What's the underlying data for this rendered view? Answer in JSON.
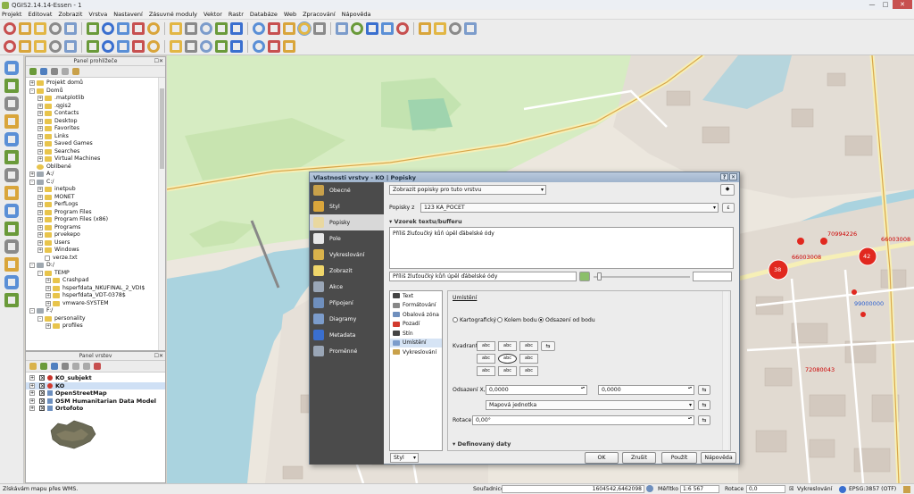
{
  "window": {
    "title": "QGIS2.14.14-Essen - 1",
    "controls": {
      "minimize": "—",
      "maximize": "□",
      "close": "✕"
    }
  },
  "menu": [
    "Projekt",
    "Editovat",
    "Zobrazit",
    "Vrstva",
    "Nastavení",
    "Zásuvné moduly",
    "Vektor",
    "Rastr",
    "Databáze",
    "Web",
    "Zpracování",
    "Nápověda"
  ],
  "toolbar_icons": {
    "row1": [
      "new-project-icon",
      "open-project-icon",
      "save-project-icon",
      "save-as-icon",
      "print-composer-icon",
      "composer-manager-icon",
      "pan-icon",
      "pan-to-selection-icon",
      "zoom-in-icon",
      "zoom-out-icon",
      "zoom-actual-icon",
      "zoom-full-icon",
      "zoom-selection-icon",
      "zoom-layer-icon",
      "zoom-last-icon",
      "zoom-next-icon",
      "new-map-view-icon",
      "refresh-icon",
      "identify-icon",
      "measure-icon",
      "select-icon",
      "deselect-icon",
      "attribute-table-icon",
      "statistics-icon",
      "calculator-icon",
      "annotation-icon",
      "text-annotation-icon",
      "map-tips-icon",
      "help-icon"
    ],
    "row2": [
      "toggle-edit-icon",
      "digitize-icon",
      "save-edits-icon",
      "add-feature-icon",
      "move-feature-icon",
      "node-tool-icon",
      "delete-icon",
      "cut-icon",
      "copy-icon",
      "paste-icon",
      "label-tool-icon",
      "pin-label-icon",
      "highlight-label-icon",
      "move-label-icon",
      "rotate-label-icon",
      "change-label-icon",
      "csw-icon",
      "python-icon"
    ]
  },
  "left_tools": [
    "add-vector-icon",
    "add-raster-icon",
    "add-postgis-icon",
    "add-spatialite-icon",
    "add-mssql-icon",
    "add-oracle-icon",
    "add-wms-icon",
    "add-wcs-icon",
    "add-wfs-icon",
    "add-delimited-icon",
    "add-virtual-icon",
    "new-shapefile-icon",
    "new-temp-layer-icon",
    "add-vector-dropdown-icon"
  ],
  "browser_panel": {
    "title": "Panel prohlížeče",
    "items": [
      {
        "label": "Projekt domů",
        "level": 0,
        "type": "folder",
        "exp": "+"
      },
      {
        "label": "Domů",
        "level": 0,
        "type": "folder",
        "exp": "-"
      },
      {
        "label": ".matplotlib",
        "level": 1,
        "type": "folder",
        "exp": "+"
      },
      {
        "label": ".qgis2",
        "level": 1,
        "type": "folder",
        "exp": "+"
      },
      {
        "label": "Contacts",
        "level": 1,
        "type": "folder",
        "exp": "+"
      },
      {
        "label": "Desktop",
        "level": 1,
        "type": "folder",
        "exp": "+"
      },
      {
        "label": "Favorites",
        "level": 1,
        "type": "folder",
        "exp": "+"
      },
      {
        "label": "Links",
        "level": 1,
        "type": "folder",
        "exp": "+"
      },
      {
        "label": "Saved Games",
        "level": 1,
        "type": "folder",
        "exp": "+"
      },
      {
        "label": "Searches",
        "level": 1,
        "type": "folder",
        "exp": "+"
      },
      {
        "label": "Virtual Machines",
        "level": 1,
        "type": "folder",
        "exp": "+"
      },
      {
        "label": "Oblíbené",
        "level": 0,
        "type": "star",
        "exp": ""
      },
      {
        "label": "A:/",
        "level": 0,
        "type": "drive",
        "exp": "+"
      },
      {
        "label": "C:/",
        "level": 0,
        "type": "drive",
        "exp": "-"
      },
      {
        "label": "inetpub",
        "level": 1,
        "type": "folder",
        "exp": "+"
      },
      {
        "label": "MONET",
        "level": 1,
        "type": "folder",
        "exp": "+"
      },
      {
        "label": "PerfLogs",
        "level": 1,
        "type": "folder",
        "exp": "+"
      },
      {
        "label": "Program Files",
        "level": 1,
        "type": "folder",
        "exp": "+"
      },
      {
        "label": "Program Files (x86)",
        "level": 1,
        "type": "folder",
        "exp": "+"
      },
      {
        "label": "Programs",
        "level": 1,
        "type": "folder",
        "exp": "+"
      },
      {
        "label": "prvekepo",
        "level": 1,
        "type": "folder",
        "exp": "+"
      },
      {
        "label": "Users",
        "level": 1,
        "type": "folder",
        "exp": "+"
      },
      {
        "label": "Windows",
        "level": 1,
        "type": "folder",
        "exp": "+"
      },
      {
        "label": "verze.txt",
        "level": 1,
        "type": "file",
        "exp": ""
      },
      {
        "label": "D:/",
        "level": 0,
        "type": "drive",
        "exp": "-"
      },
      {
        "label": "TEMP",
        "level": 1,
        "type": "folder",
        "exp": "-"
      },
      {
        "label": "Crashpad",
        "level": 2,
        "type": "folder",
        "exp": "+"
      },
      {
        "label": "hsperfdata_NKUFINAL_2_VDI$",
        "level": 2,
        "type": "folder",
        "exp": "+"
      },
      {
        "label": "hsperfdata_VDT-0378$",
        "level": 2,
        "type": "folder",
        "exp": "+"
      },
      {
        "label": "vmware-SYSTEM",
        "level": 2,
        "type": "folder",
        "exp": "+"
      },
      {
        "label": "F:/",
        "level": 0,
        "type": "drive",
        "exp": "-"
      },
      {
        "label": "personality",
        "level": 1,
        "type": "folder",
        "exp": "-"
      },
      {
        "label": "profiles",
        "level": 2,
        "type": "folder",
        "exp": "+"
      }
    ]
  },
  "layers_panel": {
    "title": "Panel vrstev",
    "layers": [
      {
        "name": "KO_subjekt",
        "checked": "✕",
        "color": "#c8322a",
        "selected": false,
        "indent": 0
      },
      {
        "name": "KO",
        "checked": "✕",
        "color": "#d23a2e",
        "selected": true,
        "indent": 0
      },
      {
        "name": "OpenStreetMap",
        "checked": "✕",
        "color": "#6c8fbf",
        "selected": false,
        "indent": 0
      },
      {
        "name": "OSM Humanitarian Data Model",
        "checked": "✕",
        "color": "#6c8fbf",
        "selected": false,
        "indent": 0
      },
      {
        "name": "Ortofoto",
        "checked": "✕",
        "color": "#6c8fbf",
        "selected": false,
        "indent": 0
      }
    ]
  },
  "map": {
    "labels": [
      {
        "text": "70994226"
      },
      {
        "text": "66003008"
      },
      {
        "text": "66003008"
      },
      {
        "text": "99000000"
      },
      {
        "text": "72080043"
      }
    ],
    "points": [
      {
        "label": "38"
      },
      {
        "label": "42"
      }
    ]
  },
  "dialog": {
    "title": "Vlastnosti vrstvy - KO | Popisky",
    "nav": [
      {
        "label": "Obecné",
        "icon": "wrench-icon",
        "color": "#c9a14a"
      },
      {
        "label": "Styl",
        "icon": "brush-icon",
        "color": "#d9a53b"
      },
      {
        "label": "Popisky",
        "icon": "label-icon",
        "color": "#e9d8a0",
        "active": true
      },
      {
        "label": "Pole",
        "icon": "fields-icon",
        "color": "#e8e8e8"
      },
      {
        "label": "Vykreslování",
        "icon": "paint-icon",
        "color": "#d9b24b"
      },
      {
        "label": "Zobrazit",
        "icon": "tooltip-icon",
        "color": "#f0d66a"
      },
      {
        "label": "Akce",
        "icon": "gear-icon",
        "color": "#9aa6b6"
      },
      {
        "label": "Připojení",
        "icon": "join-icon",
        "color": "#6f8fbd"
      },
      {
        "label": "Diagramy",
        "icon": "diagram-icon",
        "color": "#7c9ccb"
      },
      {
        "label": "Metadata",
        "icon": "info-icon",
        "color": "#3a6fcf"
      },
      {
        "label": "Proměnné",
        "icon": "variable-icon",
        "color": "#9aa6b6"
      }
    ],
    "mode_select": "Zobrazit popisky pro tuto vrstvu",
    "label_with_caption": "Popisky z",
    "label_field": "123 KA_POCET",
    "preview_section": "Vzorek textu/bufferu",
    "preview_text": "Příliš žluťoučký kůň úpěl ďábelské ódy",
    "sample_input": "Příliš žluťoučký kůň úpěl ďábelské ódy",
    "subnav": [
      {
        "label": "Text",
        "color": "#444"
      },
      {
        "label": "Formátování",
        "color": "#888"
      },
      {
        "label": "Obalová zóna",
        "color": "#6f8fbd"
      },
      {
        "label": "Pozadí",
        "color": "#d23a2e"
      },
      {
        "label": "Stín",
        "color": "#444"
      },
      {
        "label": "Umístění",
        "color": "#7c9ccb",
        "active": true
      },
      {
        "label": "Vykreslování",
        "color": "#c9a14a"
      }
    ],
    "placement": {
      "heading": "Umístění",
      "radios": [
        {
          "label": "Kartografický",
          "on": false
        },
        {
          "label": "Kolem bodu",
          "on": false
        },
        {
          "label": "Odsazení od bodu",
          "on": true
        }
      ],
      "quadrant_label": "Kvadrant",
      "quadrant_btn": "abc",
      "offset_label": "Odsazení X,Y",
      "offset_x": "0,0000",
      "offset_y": "0,0000",
      "units": "Mapová jednotka",
      "rotation_label": "Rotace",
      "rotation": "0,00°",
      "defined_section": "Definovaný daty"
    },
    "buttons": {
      "style": "Styl",
      "ok": "OK",
      "cancel": "Zrušit",
      "apply": "Použít",
      "help": "Nápověda"
    }
  },
  "statusbar": {
    "message": "Získávám mapu přes WMS.",
    "coord_label": "Souřadnice",
    "coord_value": "1604542,6462098",
    "scale_label": "Měřítko",
    "scale_value": "1:6 567",
    "rotation_label": "Rotace",
    "rotation_value": "0,0",
    "render_label": "Vykreslování",
    "crs": "EPSG:3857 (OTF)"
  },
  "colors": {
    "water": "#aad3df",
    "park": "#c8facc",
    "forest": "#add19e",
    "road_major": "#f7fabf",
    "buildings": "#d9d0c9",
    "point_fill": "#e1281f"
  }
}
